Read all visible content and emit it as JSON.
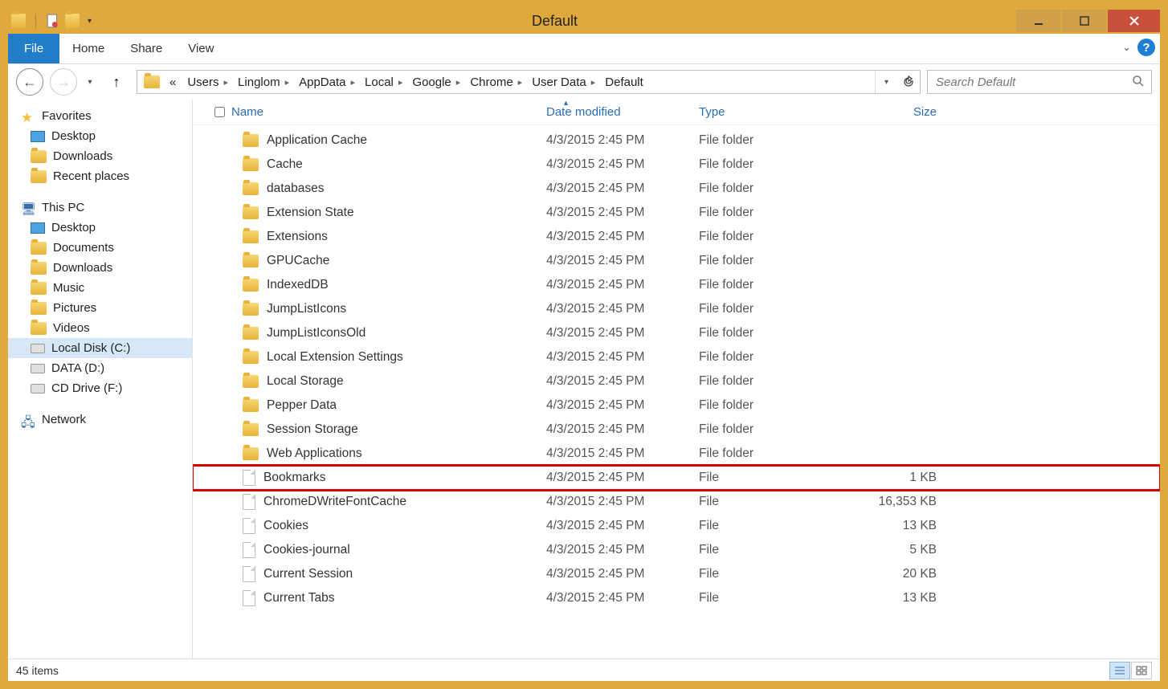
{
  "window": {
    "title": "Default"
  },
  "ribbon": {
    "file": "File",
    "tabs": [
      "Home",
      "Share",
      "View"
    ]
  },
  "breadcrumbs": {
    "prefix": "«",
    "items": [
      "Users",
      "Linglom",
      "AppData",
      "Local",
      "Google",
      "Chrome",
      "User Data",
      "Default"
    ]
  },
  "search": {
    "placeholder": "Search Default"
  },
  "sidebar": {
    "favorites": {
      "label": "Favorites",
      "items": [
        "Desktop",
        "Downloads",
        "Recent places"
      ]
    },
    "thispc": {
      "label": "This PC",
      "items": [
        "Desktop",
        "Documents",
        "Downloads",
        "Music",
        "Pictures",
        "Videos",
        "Local Disk (C:)",
        "DATA (D:)",
        "CD Drive (F:)"
      ],
      "selected_index": 6
    },
    "network": {
      "label": "Network"
    }
  },
  "columns": {
    "name": "Name",
    "date": "Date modified",
    "type": "Type",
    "size": "Size"
  },
  "items": [
    {
      "name": "Application Cache",
      "date": "4/3/2015 2:45 PM",
      "type": "File folder",
      "size": "",
      "kind": "folder",
      "hl": false
    },
    {
      "name": "Cache",
      "date": "4/3/2015 2:45 PM",
      "type": "File folder",
      "size": "",
      "kind": "folder",
      "hl": false
    },
    {
      "name": "databases",
      "date": "4/3/2015 2:45 PM",
      "type": "File folder",
      "size": "",
      "kind": "folder",
      "hl": false
    },
    {
      "name": "Extension State",
      "date": "4/3/2015 2:45 PM",
      "type": "File folder",
      "size": "",
      "kind": "folder",
      "hl": false
    },
    {
      "name": "Extensions",
      "date": "4/3/2015 2:45 PM",
      "type": "File folder",
      "size": "",
      "kind": "folder",
      "hl": false
    },
    {
      "name": "GPUCache",
      "date": "4/3/2015 2:45 PM",
      "type": "File folder",
      "size": "",
      "kind": "folder",
      "hl": false
    },
    {
      "name": "IndexedDB",
      "date": "4/3/2015 2:45 PM",
      "type": "File folder",
      "size": "",
      "kind": "folder",
      "hl": false
    },
    {
      "name": "JumpListIcons",
      "date": "4/3/2015 2:45 PM",
      "type": "File folder",
      "size": "",
      "kind": "folder",
      "hl": false
    },
    {
      "name": "JumpListIconsOld",
      "date": "4/3/2015 2:45 PM",
      "type": "File folder",
      "size": "",
      "kind": "folder",
      "hl": false
    },
    {
      "name": "Local Extension Settings",
      "date": "4/3/2015 2:45 PM",
      "type": "File folder",
      "size": "",
      "kind": "folder",
      "hl": false
    },
    {
      "name": "Local Storage",
      "date": "4/3/2015 2:45 PM",
      "type": "File folder",
      "size": "",
      "kind": "folder",
      "hl": false
    },
    {
      "name": "Pepper Data",
      "date": "4/3/2015 2:45 PM",
      "type": "File folder",
      "size": "",
      "kind": "folder",
      "hl": false
    },
    {
      "name": "Session Storage",
      "date": "4/3/2015 2:45 PM",
      "type": "File folder",
      "size": "",
      "kind": "folder",
      "hl": false
    },
    {
      "name": "Web Applications",
      "date": "4/3/2015 2:45 PM",
      "type": "File folder",
      "size": "",
      "kind": "folder",
      "hl": false
    },
    {
      "name": "Bookmarks",
      "date": "4/3/2015 2:45 PM",
      "type": "File",
      "size": "1 KB",
      "kind": "file",
      "hl": true
    },
    {
      "name": "ChromeDWriteFontCache",
      "date": "4/3/2015 2:45 PM",
      "type": "File",
      "size": "16,353 KB",
      "kind": "file",
      "hl": false
    },
    {
      "name": "Cookies",
      "date": "4/3/2015 2:45 PM",
      "type": "File",
      "size": "13 KB",
      "kind": "file",
      "hl": false
    },
    {
      "name": "Cookies-journal",
      "date": "4/3/2015 2:45 PM",
      "type": "File",
      "size": "5 KB",
      "kind": "file",
      "hl": false
    },
    {
      "name": "Current Session",
      "date": "4/3/2015 2:45 PM",
      "type": "File",
      "size": "20 KB",
      "kind": "file",
      "hl": false
    },
    {
      "name": "Current Tabs",
      "date": "4/3/2015 2:45 PM",
      "type": "File",
      "size": "13 KB",
      "kind": "file",
      "hl": false
    }
  ],
  "statusbar": {
    "text": "45 items"
  }
}
